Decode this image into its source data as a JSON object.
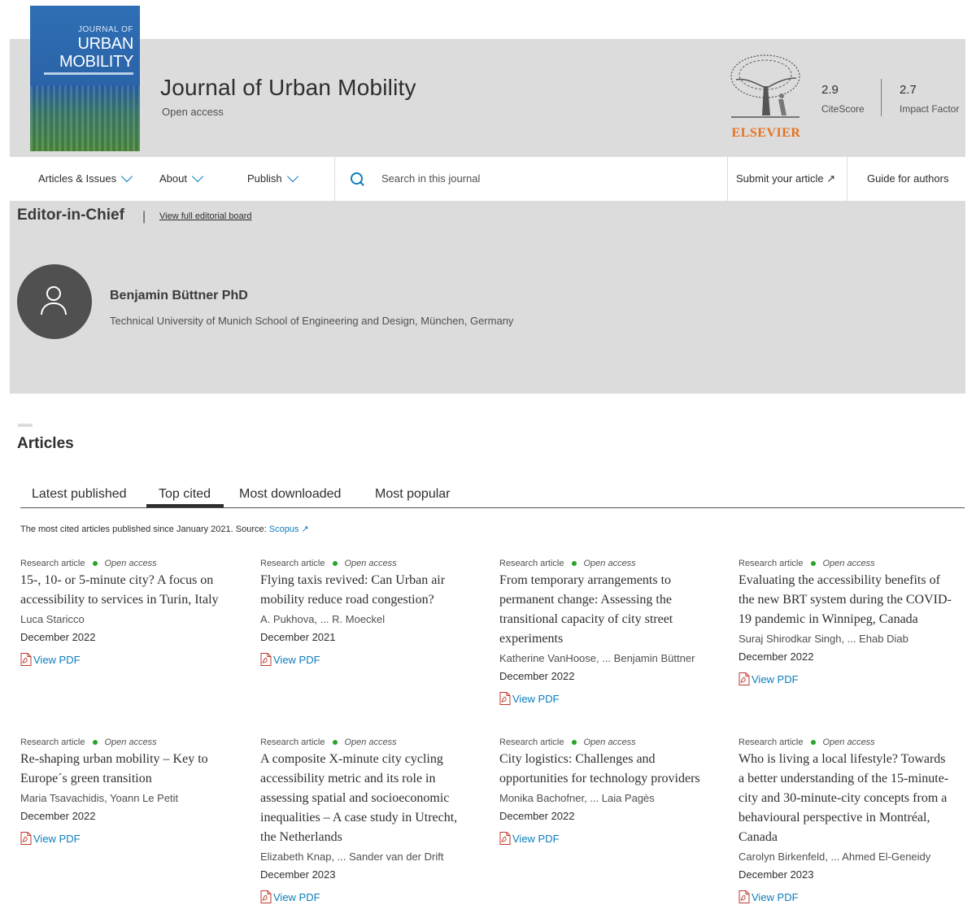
{
  "header": {
    "cover": {
      "line1": "JOURNAL OF",
      "line2": "URBAN",
      "line3": "MOBILITY"
    },
    "title": "Journal of Urban Mobility",
    "access": "Open access",
    "publisher_logo": "ELSEVIER",
    "metrics": [
      {
        "value": "2.9",
        "label": "CiteScore"
      },
      {
        "value": "2.7",
        "label": "Impact Factor"
      }
    ]
  },
  "nav": {
    "items": [
      "Articles & Issues",
      "About",
      "Publish"
    ],
    "search_placeholder": "Search in this journal",
    "submit": "Submit your article ↗",
    "guide": "Guide for authors"
  },
  "editor": {
    "heading": "Editor-in-Chief",
    "separator": "|",
    "board_link": "View full editorial board",
    "name": "Benjamin Büttner PhD",
    "affiliation": "Technical University of Munich School of Engineering and Design, München, Germany"
  },
  "articles": {
    "heading": "Articles",
    "tabs": [
      "Latest published",
      "Top cited",
      "Most downloaded",
      "Most popular"
    ],
    "active_tab": "Top cited",
    "note": "The most cited articles published since January 2021. Source:",
    "note_link": "Scopus ↗",
    "type_label": "Research article",
    "oa_label": "Open access",
    "pdf_label": "View PDF",
    "items": [
      {
        "title": "15-, 10- or 5-minute city? A focus on accessibility to services in Turin, Italy",
        "authors": "Luca Staricco",
        "date": "December 2022"
      },
      {
        "title": "Flying taxis revived: Can Urban air mobility reduce road congestion?",
        "authors": "A. Pukhova, ... R. Moeckel",
        "date": "December 2021"
      },
      {
        "title": "From temporary arrangements to permanent change: Assessing the transitional capacity of city street experiments",
        "authors": "Katherine VanHoose, ... Benjamin Büttner",
        "date": "December 2022"
      },
      {
        "title": "Evaluating the accessibility benefits of the new BRT system during the COVID-19 pandemic in Winnipeg, Canada",
        "authors": "Suraj Shirodkar Singh, ... Ehab Diab",
        "date": "December 2022"
      },
      {
        "title": "Re-shaping urban mobility – Key to Europe´s green transition",
        "authors": "Maria Tsavachidis, Yoann Le Petit",
        "date": "December 2022"
      },
      {
        "title": "A composite X-minute city cycling accessibility metric and its role in assessing spatial and socioeconomic inequalities – A case study in Utrecht, the Netherlands",
        "authors": "Elizabeth Knap, ... Sander van der Drift",
        "date": "December 2023"
      },
      {
        "title": "City logistics: Challenges and opportunities for technology providers",
        "authors": "Monika Bachofner, ... Laia Pagès",
        "date": "December 2022"
      },
      {
        "title": "Who is living a local lifestyle? Towards a better understanding of the 15-minute-city and 30-minute-city concepts from a behavioural perspective in Montréal, Canada",
        "authors": "Carolyn Birkenfeld, ... Ahmed El-Geneidy",
        "date": "December 2023"
      }
    ]
  },
  "colors": {
    "header_bg": "#dcdcdc",
    "link": "#0c7dbb",
    "oa_dot": "#29a329",
    "elsevier": "#e9711c"
  }
}
